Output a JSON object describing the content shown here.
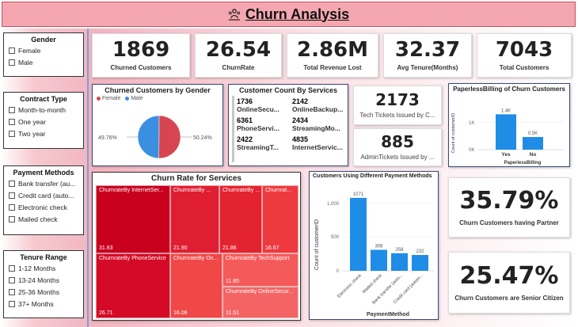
{
  "title": "Churn Analysis",
  "slicers": {
    "gender": {
      "header": "Gender",
      "options": [
        "Female",
        "Male"
      ]
    },
    "contract": {
      "header": "Contract Type",
      "options": [
        "Month-to-month",
        "One year",
        "Two year"
      ]
    },
    "payment": {
      "header": "Payment Methods",
      "options": [
        "Bank transfer (au...",
        "Credit card (auto...",
        "Electronic check",
        "Mailed check"
      ]
    },
    "tenure": {
      "header": "Tenure Range",
      "options": [
        "1-12 Months",
        "13-24 Months",
        "25-36 Months",
        "37+ Months"
      ]
    }
  },
  "kpis": [
    {
      "value": "1869",
      "label": "Churned Customers"
    },
    {
      "value": "26.54",
      "label": "ChurnRate"
    },
    {
      "value": "2.86M",
      "label": "Total Revenue Lost"
    },
    {
      "value": "32.37",
      "label": "Avg Tenure(Months)"
    },
    {
      "value": "7043",
      "label": "Total Customers"
    }
  ],
  "gender_pie": {
    "title": "Churned Customers by Gender",
    "legend": [
      "Female",
      "Male"
    ],
    "female_pct_label": "50.24%",
    "male_pct_label": "49.76%",
    "colors": {
      "Female": "#d64550",
      "Male": "#3b8fe0"
    }
  },
  "services": {
    "title": "Customer Count By Services",
    "items": [
      {
        "num": "1736",
        "label": "OnlineSecu..."
      },
      {
        "num": "2142",
        "label": "OnlineBackup..."
      },
      {
        "num": "6361",
        "label": "PhoneServi..."
      },
      {
        "num": "2434",
        "label": "StreamingMo..."
      },
      {
        "num": "2422",
        "label": "StreamingT..."
      },
      {
        "num": "4835",
        "label": "InternetServic..."
      }
    ]
  },
  "tickets": [
    {
      "value": "2173",
      "label": "Tech Tickets Issued by C..."
    },
    {
      "value": "885",
      "label": "AdminTickets Issued by ..."
    }
  ],
  "paperless": {
    "title": "PaperlessBilling of Churn Customers",
    "ylabel": "Count of customerID",
    "xlabel": "PaperlessBilling",
    "ticks": [
      "1K",
      "0K"
    ],
    "color": "#1f8ce6"
  },
  "treemap": {
    "title": "Churn Rate for Services",
    "cells": [
      {
        "name": "ChurnrateBy InternetSer...",
        "value": "31.83"
      },
      {
        "name": "ChurnrateBy ...",
        "value": "21.90"
      },
      {
        "name": "ChurnrateBy ...",
        "value": "21.86"
      },
      {
        "name": "Churnrat...",
        "value": "16.67"
      },
      {
        "name": "ChurnrateBy PhoneService",
        "value": "26.71"
      },
      {
        "name": "ChurnrateBy On...",
        "value": "16.08"
      },
      {
        "name": "ChurnrateBy TechSupport",
        "value": "11.85"
      },
      {
        "name": "ChurnrateBy OnlineSecur...",
        "value": "11.51"
      }
    ]
  },
  "payment_chart": {
    "title": "Customers Using Different Payment Methods",
    "ylabel": "Count of customerID",
    "xlabel": "PaymentMethod",
    "ticks": [
      "1,000",
      "500",
      "0"
    ],
    "color": "#1f8ce6"
  },
  "stats": [
    {
      "value": "35.79%",
      "label": "Churn Customers having Partner"
    },
    {
      "value": "25.47%",
      "label": "Churn Customers are Senior Citizen"
    }
  ],
  "chart_data": [
    {
      "type": "pie",
      "title": "Churned Customers by Gender",
      "categories": [
        "Female",
        "Male"
      ],
      "values": [
        50.24,
        49.76
      ]
    },
    {
      "type": "bar",
      "title": "PaperlessBilling of Churn Customers",
      "categories": [
        "Yes",
        "No"
      ],
      "values": [
        1400,
        500
      ],
      "value_labels": [
        "1.4K",
        "0.5K"
      ],
      "xlabel": "PaperlessBilling",
      "ylabel": "Count of customerID",
      "ylim": [
        0,
        1600
      ]
    },
    {
      "type": "bar",
      "title": "Customers Using Different Payment Methods",
      "categories": [
        "Electronic check",
        "Mailed check",
        "Bank transfer (auto...",
        "Credit card (autom..."
      ],
      "values": [
        1071,
        308,
        258,
        232
      ],
      "xlabel": "PaymentMethod",
      "ylabel": "Count of customerID",
      "ylim": [
        0,
        1150
      ]
    }
  ]
}
